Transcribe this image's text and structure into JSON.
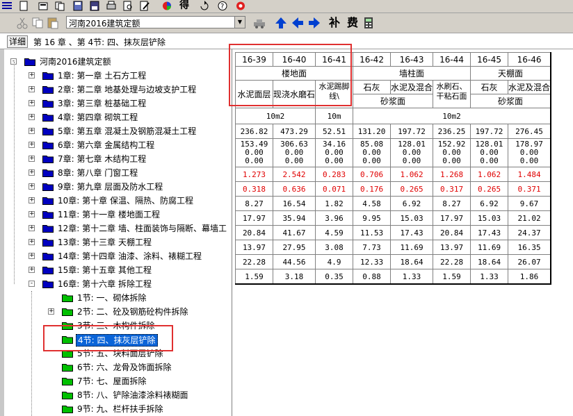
{
  "toolbar": {
    "combo_value": "河南2016建筑定额",
    "text_button_1": "补",
    "text_button_2": "费",
    "text_button_top": "得"
  },
  "breadcrumb": {
    "detail_label": "详细",
    "path": "第 16 章 、第 4节: 四、抹灰层铲除"
  },
  "tree": {
    "root": "河南2016建筑定额",
    "chapters": [
      "1章: 第一章 土石方工程",
      "2章: 第二章 地基处理与边坡支护工程",
      "3章: 第三章 桩基础工程",
      "4章: 第四章 砌筑工程",
      "5章: 第五章 混凝土及钢筋混凝土工程",
      "6章: 第六章 金属结构工程",
      "7章: 第七章 木结构工程",
      "8章: 第八章 门窗工程",
      "9章: 第九章 层面及防水工程",
      "10章: 第十章 保温、隔热、防腐工程",
      "11章: 第十一章 楼地面工程",
      "12章: 第十二章 墙、柱面装饰与隔断、幕墙工",
      "13章: 第十三章 天棚工程",
      "14章: 第十四章 油漆、涂料、裱糊工程",
      "15章: 第十五章 其他工程",
      "16章: 第十六章 拆除工程"
    ],
    "sections": [
      "1节: 一、砌体拆除",
      "2节: 二、砼及钢筋砼构件拆除",
      "3节: 三、木构件拆除",
      "4节: 四、抹灰层铲除",
      "5节: 五、块料面层铲除",
      "6节: 六、龙骨及饰面拆除",
      "7节: 七、屋面拆除",
      "8节: 八、铲除油漆涂料裱糊面",
      "9节: 九、栏杆扶手拆除"
    ],
    "selected_section": 3
  },
  "grid": {
    "codes": [
      "16-39",
      "16-40",
      "16-41",
      "16-42",
      "16-43",
      "16-44",
      "16-45",
      "16-46"
    ],
    "group_labels": [
      "楼地面",
      "墙柱面",
      "天棚面"
    ],
    "sub_names": [
      "水泥面层",
      "现浇水磨石",
      "水泥踢脚线\\",
      "石灰",
      "水泥及混合",
      "水刷石、干粘石面",
      "石灰",
      "水泥及混合"
    ],
    "material_labels": [
      "砂浆面",
      "砂浆面"
    ],
    "units": [
      "10m2",
      "10m",
      "10m2"
    ],
    "base_price": [
      "236.82",
      "473.29",
      "52.51",
      "131.20",
      "197.72",
      "236.25",
      "197.72",
      "276.45"
    ],
    "labor_lines": [
      [
        "153.49",
        "306.63",
        "34.16",
        "85.08",
        "128.01",
        "152.92",
        "128.01",
        "178.97"
      ],
      [
        "0.00",
        "0.00",
        "0.00",
        "0.00",
        "0.00",
        "0.00",
        "0.00",
        "0.00"
      ],
      [
        "0.00",
        "0.00",
        "0.00",
        "0.00",
        "0.00",
        "0.00",
        "0.00",
        "0.00"
      ]
    ],
    "red_rows": [
      [
        "1.273",
        "2.542",
        "0.283",
        "0.706",
        "1.062",
        "1.268",
        "1.062",
        "1.484"
      ],
      [
        "0.318",
        "0.636",
        "0.071",
        "0.176",
        "0.265",
        "0.317",
        "0.265",
        "0.371"
      ]
    ],
    "rows": [
      [
        "8.27",
        "16.54",
        "1.82",
        "4.58",
        "6.92",
        "8.27",
        "6.92",
        "9.67"
      ],
      [
        "17.97",
        "35.94",
        "3.96",
        "9.95",
        "15.03",
        "17.97",
        "15.03",
        "21.02"
      ],
      [
        "20.84",
        "41.67",
        "4.59",
        "11.53",
        "17.43",
        "20.84",
        "17.43",
        "24.37"
      ],
      [
        "13.97",
        "27.95",
        "3.08",
        "7.73",
        "11.69",
        "13.97",
        "11.69",
        "16.35"
      ],
      [
        "22.28",
        "44.56",
        "4.9",
        "12.33",
        "18.64",
        "22.28",
        "18.64",
        "26.07"
      ],
      [
        "1.59",
        "3.18",
        "0.35",
        "0.88",
        "1.33",
        "1.59",
        "1.33",
        "1.86"
      ]
    ],
    "red_color": "#e00000"
  },
  "colors": {
    "selection": "#0a64d8",
    "annotation": "#e03030",
    "folder_blue": "#0000c0",
    "folder_green": "#00c000"
  }
}
